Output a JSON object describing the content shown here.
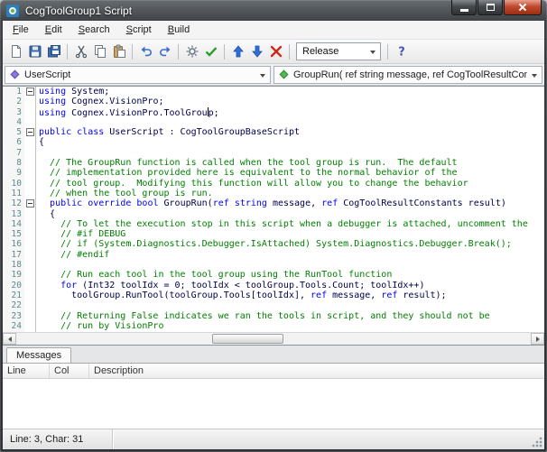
{
  "window": {
    "title": "CogToolGroup1 Script"
  },
  "menu": {
    "items": [
      "File",
      "Edit",
      "Search",
      "Script",
      "Build"
    ]
  },
  "toolbar": {
    "icons": [
      "new-icon",
      "save-icon",
      "save-all-icon",
      "cut-icon",
      "copy-icon",
      "paste-icon",
      "undo-icon",
      "redo-icon",
      "compile-icon",
      "check-icon",
      "move-up-icon",
      "move-down-icon",
      "delete-icon",
      "chevron-down-icon",
      "help-icon"
    ],
    "build_configuration": "Release"
  },
  "navigator": {
    "scope": "UserScript",
    "member": "GroupRun( ref string message,  ref CogToolResultConstants result)"
  },
  "editor": {
    "colors": {
      "keyword": "#0000ff",
      "comment": "#007f00",
      "plain": "#00004d",
      "line_number": "#5b8a8a"
    },
    "caret_position": {
      "line": 3,
      "char": 31
    },
    "lines": [
      {
        "n": 1,
        "fold": true,
        "segs": [
          [
            "k",
            "using"
          ],
          [
            "p",
            " System;"
          ]
        ]
      },
      {
        "n": 2,
        "segs": [
          [
            "k",
            "using"
          ],
          [
            "p",
            " Cognex.VisionPro;"
          ]
        ]
      },
      {
        "n": 3,
        "segs": [
          [
            "k",
            "using"
          ],
          [
            "p",
            " Cognex.VisionPro.ToolGrou"
          ],
          [
            "caret",
            ""
          ],
          [
            "p",
            "p;"
          ]
        ]
      },
      {
        "n": 4,
        "segs": []
      },
      {
        "n": 5,
        "fold": true,
        "segs": [
          [
            "k",
            "public"
          ],
          [
            "p",
            " "
          ],
          [
            "k",
            "class"
          ],
          [
            "p",
            " UserScript : CogToolGroupBaseScript"
          ]
        ]
      },
      {
        "n": 6,
        "segs": [
          [
            "p",
            "{"
          ]
        ]
      },
      {
        "n": 7,
        "segs": []
      },
      {
        "n": 8,
        "segs": [
          [
            "c",
            "  // The GroupRun function is called when the tool group is run.  The default"
          ]
        ]
      },
      {
        "n": 9,
        "segs": [
          [
            "c",
            "  // implementation provided here is equivalent to the normal behavior of the"
          ]
        ]
      },
      {
        "n": 10,
        "segs": [
          [
            "c",
            "  // tool group.  Modifying this function will allow you to change the behavior"
          ]
        ]
      },
      {
        "n": 11,
        "segs": [
          [
            "c",
            "  // when the tool group is run."
          ]
        ]
      },
      {
        "n": 12,
        "fold": true,
        "segs": [
          [
            "p",
            "  "
          ],
          [
            "k",
            "public"
          ],
          [
            "p",
            " "
          ],
          [
            "k",
            "override"
          ],
          [
            "p",
            " "
          ],
          [
            "k",
            "bool"
          ],
          [
            "p",
            " GroupRun("
          ],
          [
            "k",
            "ref"
          ],
          [
            "p",
            " "
          ],
          [
            "k",
            "string"
          ],
          [
            "p",
            " message, "
          ],
          [
            "k",
            "ref"
          ],
          [
            "p",
            " CogToolResultConstants result)"
          ]
        ]
      },
      {
        "n": 13,
        "segs": [
          [
            "p",
            "  {"
          ]
        ]
      },
      {
        "n": 14,
        "segs": [
          [
            "c",
            "    // To let the execution stop in this script when a debugger is attached, uncomment the"
          ]
        ]
      },
      {
        "n": 15,
        "segs": [
          [
            "c",
            "    // #if DEBUG"
          ]
        ]
      },
      {
        "n": 16,
        "segs": [
          [
            "c",
            "    // if (System.Diagnostics.Debugger.IsAttached) System.Diagnostics.Debugger.Break();"
          ]
        ]
      },
      {
        "n": 17,
        "segs": [
          [
            "c",
            "    // #endif"
          ]
        ]
      },
      {
        "n": 18,
        "segs": []
      },
      {
        "n": 19,
        "segs": [
          [
            "c",
            "    // Run each tool in the tool group using the RunTool function"
          ]
        ]
      },
      {
        "n": 20,
        "segs": [
          [
            "p",
            "    "
          ],
          [
            "k",
            "for"
          ],
          [
            "p",
            " (Int32 toolIdx = 0; toolIdx < toolGroup.Tools.Count; toolIdx++)"
          ]
        ]
      },
      {
        "n": 21,
        "segs": [
          [
            "p",
            "      toolGroup.RunTool(toolGroup.Tools[toolIdx], "
          ],
          [
            "k",
            "ref"
          ],
          [
            "p",
            " message, "
          ],
          [
            "k",
            "ref"
          ],
          [
            "p",
            " result);"
          ]
        ]
      },
      {
        "n": 22,
        "segs": []
      },
      {
        "n": 23,
        "segs": [
          [
            "c",
            "    // Returning False indicates we ran the tools in script, and they should not be"
          ]
        ]
      },
      {
        "n": 24,
        "segs": [
          [
            "c",
            "    // run by VisionPro"
          ]
        ]
      }
    ]
  },
  "messages": {
    "tab": "Messages",
    "columns": [
      "Line",
      "Col",
      "Description"
    ]
  },
  "status": {
    "text": "Line: 3, Char: 31"
  }
}
